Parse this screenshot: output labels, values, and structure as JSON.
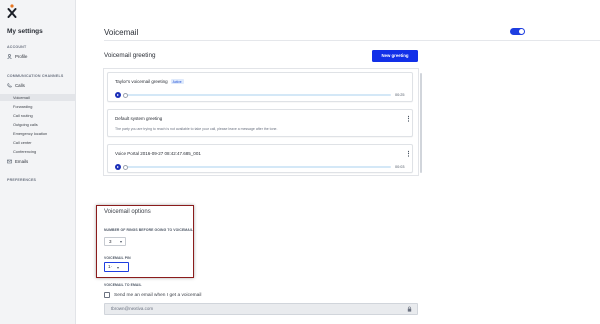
{
  "sidebar": {
    "title": "My settings",
    "account_heading": "ACCOUNT",
    "profile": "Profile",
    "comm_heading": "COMMUNICATION CHANNELS",
    "calls": "Calls",
    "calls_items": [
      "Voicemail",
      "Forwarding",
      "Call routing",
      "Outgoing calls",
      "Emergency location",
      "Call center",
      "Conferencing"
    ],
    "emails": "Emails",
    "preferences_heading": "PREFERENCES"
  },
  "header": {
    "title": "Voicemail",
    "toggle_on": true
  },
  "greeting": {
    "title": "Voicemail greeting",
    "new_button": "New greeting",
    "cards": [
      {
        "name": "Taylor's voicemail greeting",
        "badge": "Active",
        "duration": "00:25"
      },
      {
        "name": "Default system greeting",
        "description": "The party you are trying to reach is not available to take your call, please leave a message after the tone."
      },
      {
        "name": "Voice Portal 2016-09-27 08:42:47.685_001",
        "duration": "00:03"
      }
    ]
  },
  "options": {
    "title": "Voicemail options",
    "rings_label": "NUMBER OF RINGS BEFORE GOING TO VOICEMAIL",
    "rings_value": "3",
    "pin_label": "VOICEMAIL PIN",
    "pin_value": "1·",
    "to_email_label": "VOICEMAIL TO EMAIL",
    "send_email_label": "Send me an email when I get a voicemail",
    "email_value": "tbrown@nextiva.com"
  },
  "colors": {
    "accent": "#1230e8",
    "highlight_border": "#8b1c1c"
  }
}
